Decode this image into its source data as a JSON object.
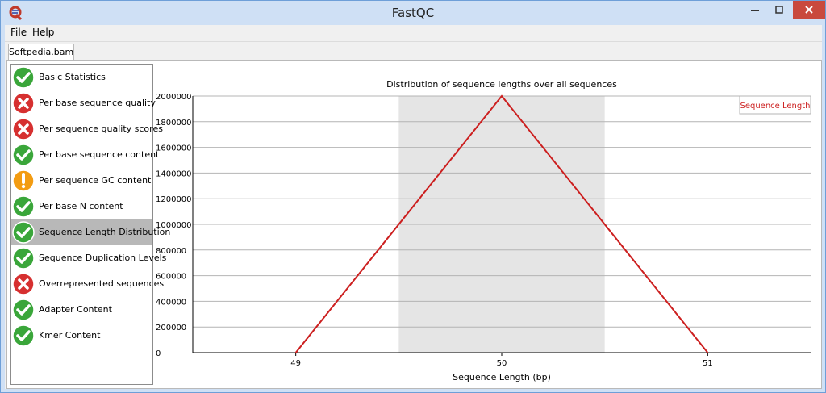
{
  "window": {
    "title": "FastQC"
  },
  "menu": {
    "items": [
      "File",
      "Help"
    ]
  },
  "tab": {
    "label": "Softpedia.bam"
  },
  "modules": [
    {
      "label": "Basic Statistics",
      "status": "pass"
    },
    {
      "label": "Per base sequence quality",
      "status": "fail"
    },
    {
      "label": "Per sequence quality scores",
      "status": "fail"
    },
    {
      "label": "Per base sequence content",
      "status": "pass"
    },
    {
      "label": "Per sequence GC content",
      "status": "warn"
    },
    {
      "label": "Per base N content",
      "status": "pass"
    },
    {
      "label": "Sequence Length Distribution",
      "status": "pass",
      "selected": true
    },
    {
      "label": "Sequence Duplication Levels",
      "status": "pass"
    },
    {
      "label": "Overrepresented sequences",
      "status": "fail"
    },
    {
      "label": "Adapter Content",
      "status": "pass"
    },
    {
      "label": "Kmer Content",
      "status": "pass"
    }
  ],
  "icons": {
    "pass": "check-icon",
    "fail": "cross-icon",
    "warn": "exclamation-icon"
  },
  "colors": {
    "pass": "#3aa63a",
    "fail": "#d63030",
    "warn": "#f39c12",
    "line": "#cc1f1f",
    "band": "#e5e5e5"
  },
  "chart_data": {
    "type": "line",
    "title": "Distribution of sequence lengths over all sequences",
    "xlabel": "Sequence Length (bp)",
    "categories": [
      "49",
      "50",
      "51"
    ],
    "y_ticks": [
      "0",
      "200000",
      "400000",
      "600000",
      "800000",
      "1000000",
      "1200000",
      "1400000",
      "1600000",
      "1800000",
      "2000000"
    ],
    "ylim": [
      0,
      2000000
    ],
    "series": [
      {
        "name": "Sequence Length",
        "values": [
          0,
          2000000,
          0
        ]
      }
    ],
    "grid": true,
    "highlight_category": "50",
    "legend": "top-right"
  }
}
